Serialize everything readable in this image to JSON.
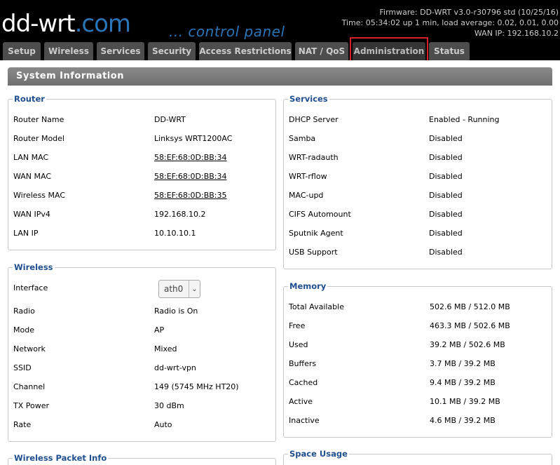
{
  "header": {
    "logo_main": "dd-wrt",
    "logo_suffix": ".com",
    "subtitle": "... control panel",
    "firmware": "Firmware: DD-WRT v3.0-r30796 std (10/25/16)",
    "time": "Time: 05:34:02 up 1 min, load average: 0.02, 0.01, 0.00",
    "wan_ip": "WAN IP: 192.168.10.2"
  },
  "tabs": [
    "Setup",
    "Wireless",
    "Services",
    "Security",
    "Access Restrictions",
    "NAT / QoS",
    "Administration",
    "Status"
  ],
  "panel_title": "System Information",
  "router": {
    "title": "Router",
    "rows": [
      {
        "label": "Router Name",
        "value": "DD-WRT"
      },
      {
        "label": "Router Model",
        "value": "Linksys WRT1200AC"
      },
      {
        "label": "LAN MAC",
        "value": "58:EF:68:0D:BB:34"
      },
      {
        "label": "WAN MAC",
        "value": "58:EF:68:0D:BB:34"
      },
      {
        "label": "Wireless MAC",
        "value": "58:EF:68:0D:BB:35"
      },
      {
        "label": "WAN IPv4",
        "value": "192.168.10.2"
      },
      {
        "label": "LAN IP",
        "value": "10.10.10.1"
      }
    ]
  },
  "wireless": {
    "title": "Wireless",
    "interface_label": "Interface",
    "interface_value": "ath0",
    "rows": [
      {
        "label": "Radio",
        "value": "Radio is On"
      },
      {
        "label": "Mode",
        "value": "AP"
      },
      {
        "label": "Network",
        "value": "Mixed"
      },
      {
        "label": "SSID",
        "value": "dd-wrt-vpn"
      },
      {
        "label": "Channel",
        "value": "149 (5745 MHz HT20)"
      },
      {
        "label": "TX Power",
        "value": "30 dBm"
      },
      {
        "label": "Rate",
        "value": "Auto"
      }
    ]
  },
  "packet_info": {
    "title": "Wireless Packet Info"
  },
  "services": {
    "title": "Services",
    "rows": [
      {
        "label": "DHCP Server",
        "value": "Enabled - Running"
      },
      {
        "label": "Samba",
        "value": "Disabled"
      },
      {
        "label": "WRT-radauth",
        "value": "Disabled"
      },
      {
        "label": "WRT-rflow",
        "value": "Disabled"
      },
      {
        "label": "MAC-upd",
        "value": "Disabled"
      },
      {
        "label": "CIFS Automount",
        "value": "Disabled"
      },
      {
        "label": "Sputnik Agent",
        "value": "Disabled"
      },
      {
        "label": "USB Support",
        "value": "Disabled"
      }
    ]
  },
  "memory": {
    "title": "Memory",
    "rows": [
      {
        "label": "Total Available",
        "value": "502.6 MB / 512.0 MB"
      },
      {
        "label": "Free",
        "value": "463.3 MB / 502.6 MB"
      },
      {
        "label": "Used",
        "value": "39.2 MB / 502.6 MB"
      },
      {
        "label": "Buffers",
        "value": "3.7 MB / 39.2 MB"
      },
      {
        "label": "Cached",
        "value": "9.4 MB / 39.2 MB"
      },
      {
        "label": "Active",
        "value": "10.1 MB / 39.2 MB"
      },
      {
        "label": "Inactive",
        "value": "4.6 MB / 39.2 MB"
      }
    ]
  },
  "space": {
    "title": "Space Usage"
  }
}
